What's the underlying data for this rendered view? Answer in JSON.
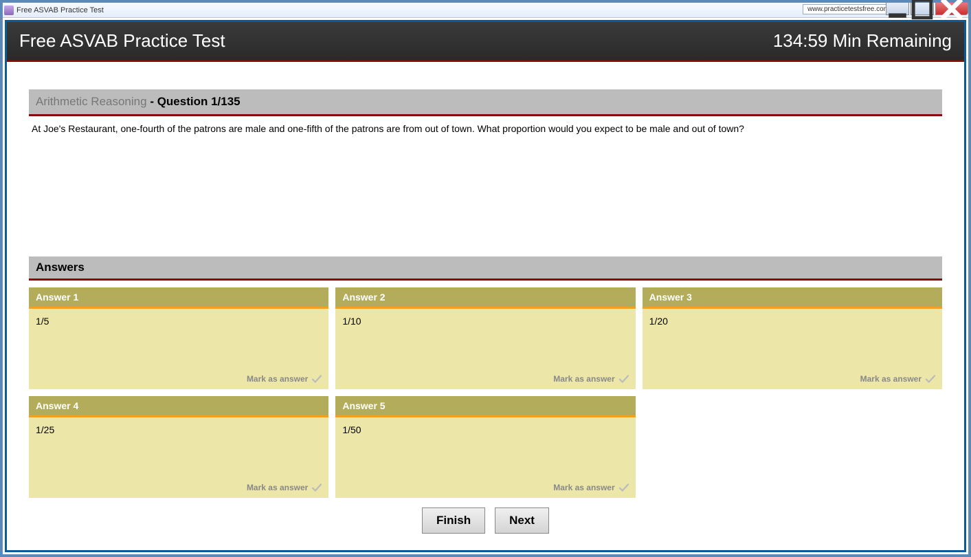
{
  "window": {
    "title": "Free ASVAB Practice Test",
    "url": "www.practicetestsfree.com"
  },
  "header": {
    "title": "Free ASVAB Practice Test",
    "timer": "134:59 Min Remaining"
  },
  "question": {
    "category": "Arithmetic Reasoning",
    "counter": "- Question 1/135",
    "text": "At Joe's Restaurant, one-fourth of the patrons are male and one-fifth of the patrons are from out of town. What proportion would you expect to be male and out of town?"
  },
  "answers_label": "Answers",
  "mark_label": "Mark as answer",
  "answers": [
    {
      "label": "Answer 1",
      "value": "1/5"
    },
    {
      "label": "Answer 2",
      "value": "1/10"
    },
    {
      "label": "Answer 3",
      "value": "1/20"
    },
    {
      "label": "Answer 4",
      "value": "1/25"
    },
    {
      "label": "Answer 5",
      "value": "1/50"
    }
  ],
  "buttons": {
    "finish": "Finish",
    "next": "Next"
  }
}
